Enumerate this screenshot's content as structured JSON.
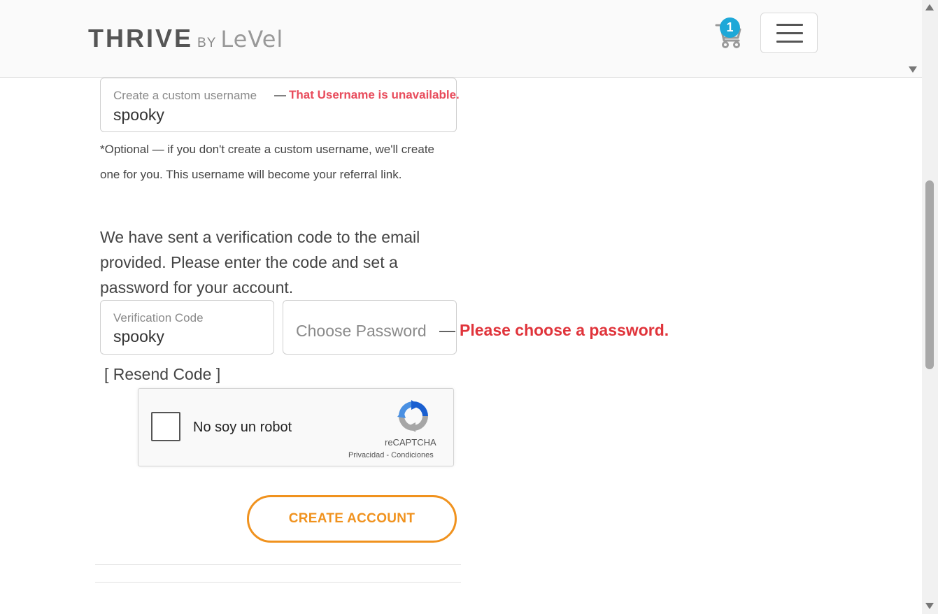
{
  "header": {
    "logo_thrive": "THRIVE",
    "logo_by": "BY",
    "logo_level": "LeVel",
    "cart_count": "1"
  },
  "username_field": {
    "label": "Create a custom username",
    "value": "spooky",
    "error": "That Username is unavailable.",
    "dash": "—"
  },
  "optional_note": "*Optional — if you don't create a custom username, we'll create one for you. This username will become your referral link.",
  "verification_message": "We have sent a verification code to the email provided. Please enter the code and set a password for your account.",
  "verification_field": {
    "label": "Verification Code",
    "value": "spooky"
  },
  "password_field": {
    "placeholder": "Choose Password",
    "error": "Please choose a password.",
    "dash": "—"
  },
  "resend_link": "[ Resend Code ]",
  "recaptcha": {
    "label": "No soy un robot",
    "brand": "reCAPTCHA",
    "privacy": "Privacidad",
    "separator": "-",
    "terms": "Condiciones"
  },
  "create_button": "CREATE ACCOUNT",
  "colors": {
    "accent_orange": "#f0921e",
    "error_red": "#e0343b",
    "badge_blue": "#1ea8d8"
  }
}
